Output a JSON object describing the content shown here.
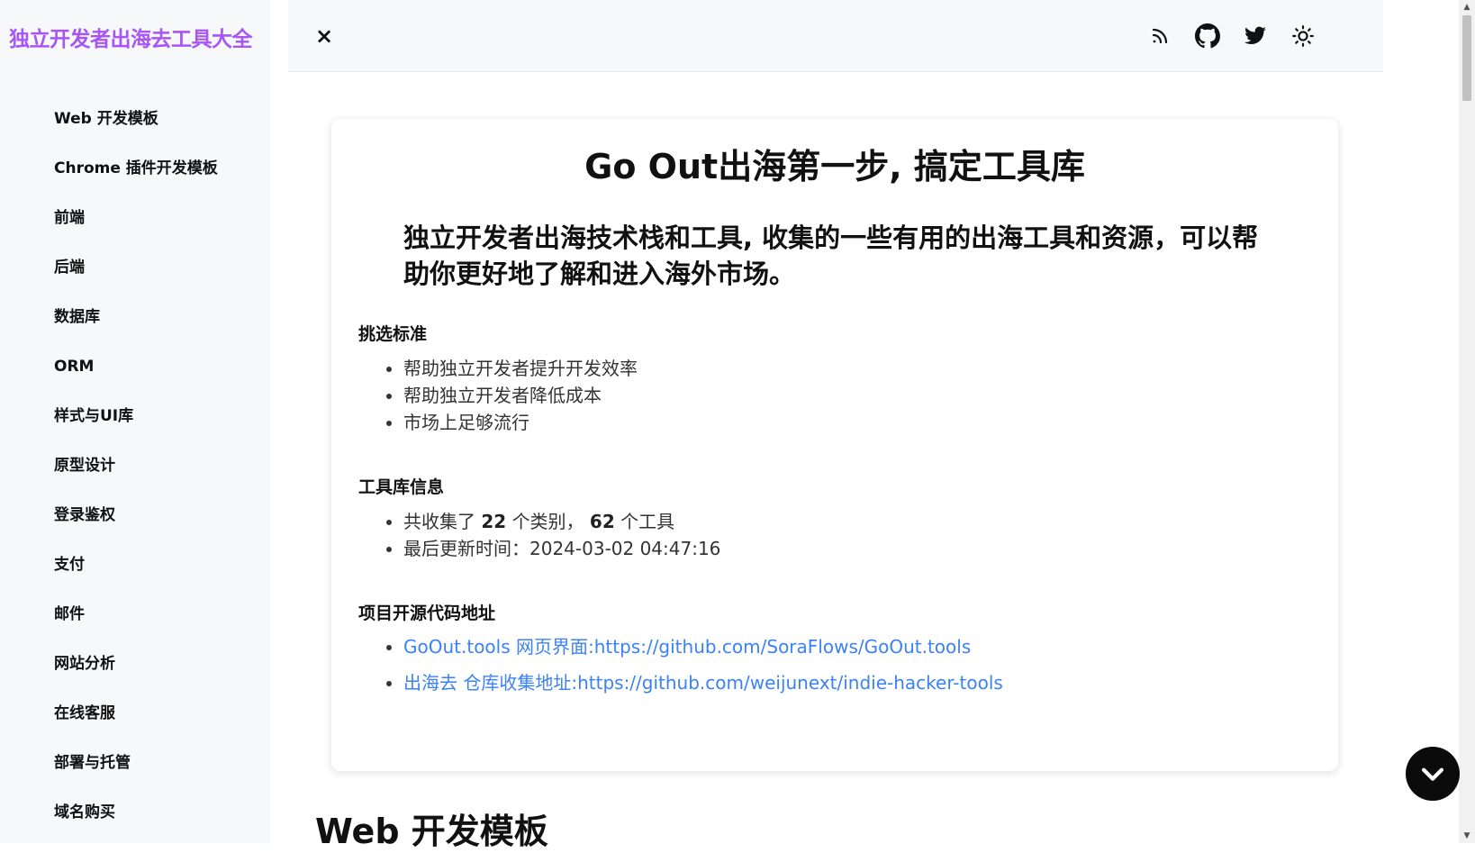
{
  "brand": {
    "title": "独立开发者出海去工具大全",
    "color": "#a855f7"
  },
  "sidebar": {
    "items": [
      {
        "label": "Web 开发模板"
      },
      {
        "label": "Chrome 插件开发模板"
      },
      {
        "label": "前端"
      },
      {
        "label": "后端"
      },
      {
        "label": "数据库"
      },
      {
        "label": "ORM"
      },
      {
        "label": "样式与UI库"
      },
      {
        "label": "原型设计"
      },
      {
        "label": "登录鉴权"
      },
      {
        "label": "支付"
      },
      {
        "label": "邮件"
      },
      {
        "label": "网站分析"
      },
      {
        "label": "在线客服"
      },
      {
        "label": "部署与托管"
      },
      {
        "label": "域名购买"
      }
    ]
  },
  "header": {
    "close_icon": "×",
    "icons": [
      "rss-icon",
      "github-icon",
      "twitter-icon",
      "sun-icon"
    ]
  },
  "intro": {
    "title": "Go Out出海第一步, 搞定工具库",
    "subtitle": "独立开发者出海技术栈和工具, 收集的一些有用的出海工具和资源，可以帮助你更好地了解和进入海外市场。",
    "criteria": {
      "heading": "挑选标准",
      "items": [
        "帮助独立开发者提升开发效率",
        "帮助独立开发者降低成本",
        "市场上足够流行"
      ]
    },
    "info": {
      "heading": "工具库信息",
      "collected_prefix": "共收集了",
      "category_count": "22",
      "category_suffix": "个类别，",
      "tool_count": "62",
      "tool_suffix": "个工具",
      "updated": "最后更新时间：2024-03-02 04:47:16"
    },
    "source": {
      "heading": "项目开源代码地址",
      "links": [
        "GoOut.tools 网页界面:https://github.com/SoraFlows/GoOut.tools",
        "出海去 仓库收集地址:https://github.com/weijunext/indie-hacker-tools"
      ]
    }
  },
  "section_heading": "Web 开发模板",
  "colors": {
    "link": "#3b82f6",
    "header_bg": "#f7f8f9",
    "fab_bg": "#0b0b0b"
  }
}
